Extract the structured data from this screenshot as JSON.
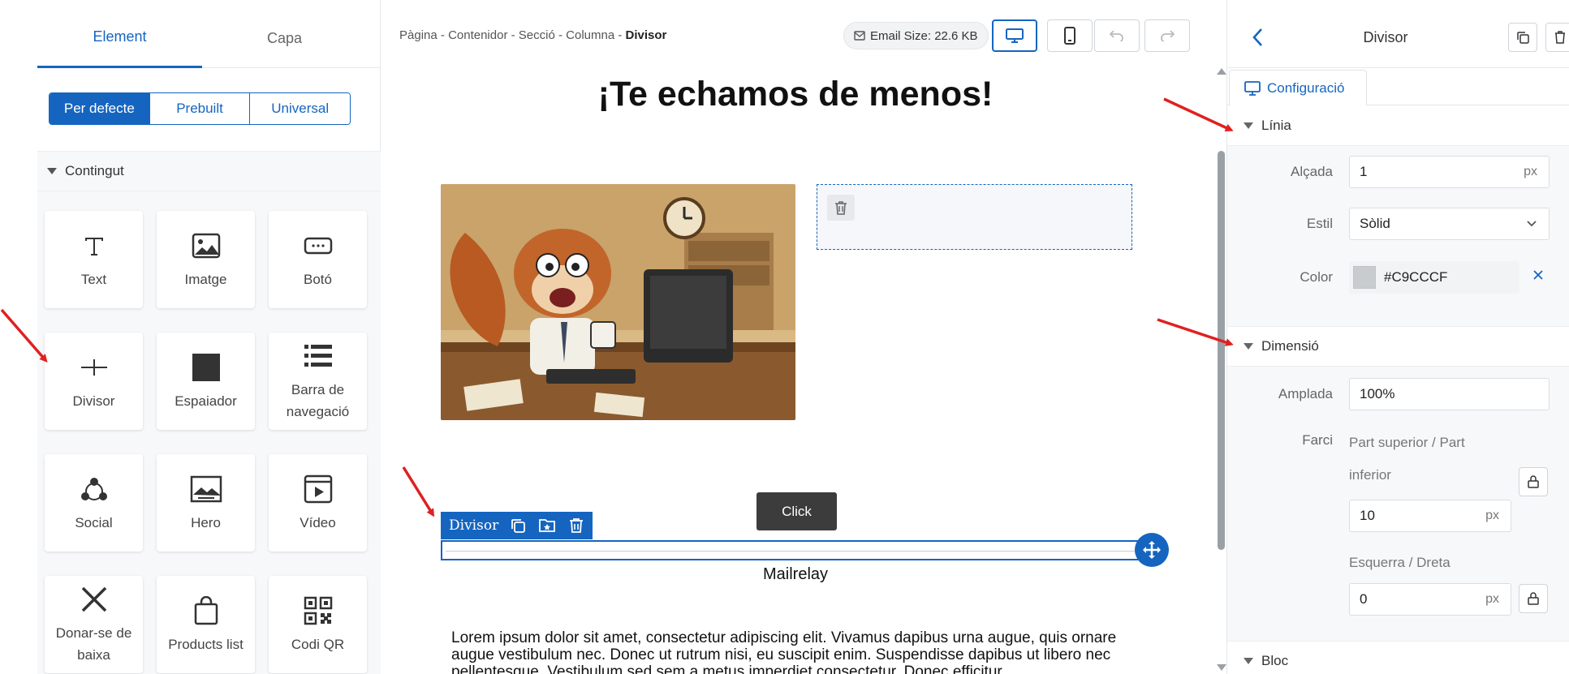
{
  "left_panel": {
    "tabs": [
      {
        "label": "Element",
        "active": true
      },
      {
        "label": "Capa",
        "active": false
      }
    ],
    "segments": [
      {
        "label": "Per defecte",
        "active": true
      },
      {
        "label": "Prebuilt",
        "active": false
      },
      {
        "label": "Universal",
        "active": false
      }
    ],
    "section_title": "Contingut",
    "items": [
      {
        "label": "Text",
        "icon": "text-icon"
      },
      {
        "label": "Imatge",
        "icon": "image-icon"
      },
      {
        "label": "Botó",
        "icon": "button-icon"
      },
      {
        "label": "Divisor",
        "icon": "divider-icon"
      },
      {
        "label": "Espaiador",
        "icon": "spacer-icon"
      },
      {
        "label": "Barra de navegació",
        "icon": "navbar-icon"
      },
      {
        "label": "Social",
        "icon": "social-icon"
      },
      {
        "label": "Hero",
        "icon": "hero-icon"
      },
      {
        "label": "Vídeo",
        "icon": "video-icon"
      },
      {
        "label": "Donar-se de baixa",
        "icon": "unsubscribe-icon"
      },
      {
        "label": "Products list",
        "icon": "products-icon"
      },
      {
        "label": "Codi QR",
        "icon": "qr-code-icon"
      }
    ]
  },
  "toolbar": {
    "breadcrumb": [
      "Pàgina",
      "Contenidor",
      "Secció",
      "Columna"
    ],
    "breadcrumb_current": "Divisor",
    "breadcrumb_sep": " - ",
    "email_size": "Email Size: 22.6 KB"
  },
  "canvas": {
    "heading": "¡Te echamos de menos!",
    "button_label": "Click",
    "divider_tag": "Divisor",
    "footer_label": "Mailrelay",
    "body_text": "Lorem ipsum dolor sit amet, consectetur adipiscing elit. Vivamus dapibus urna augue, quis ornare augue vestibulum nec. Donec ut rutrum nisi, eu suscipit enim. Suspendisse dapibus ut libero nec pellentesque. Vestibulum sed sem a metus imperdiet consectetur. Donec efficitur"
  },
  "right_panel": {
    "title": "Divisor",
    "tab_label": "Configuració",
    "linia": {
      "title": "Línia",
      "alcada_label": "Alçada",
      "alcada_value": "1",
      "alcada_unit": "px",
      "estil_label": "Estil",
      "estil_value": "Sòlid",
      "color_label": "Color",
      "color_value": "#C9CCCF"
    },
    "dimensio": {
      "title": "Dimensió",
      "amplada_label": "Amplada",
      "amplada_value": "100%",
      "farci_label": "Farci",
      "top_bottom_label": "Part superior / Part inferior",
      "top_bottom_value": "10",
      "left_right_label": "Esquerra / Dreta",
      "left_right_value": "0",
      "unit": "px"
    },
    "bloc_title": "Bloc"
  },
  "colors": {
    "accent": "#1565c0",
    "divider_line": "#c9cccf",
    "annotation_arrow": "#e02020"
  }
}
